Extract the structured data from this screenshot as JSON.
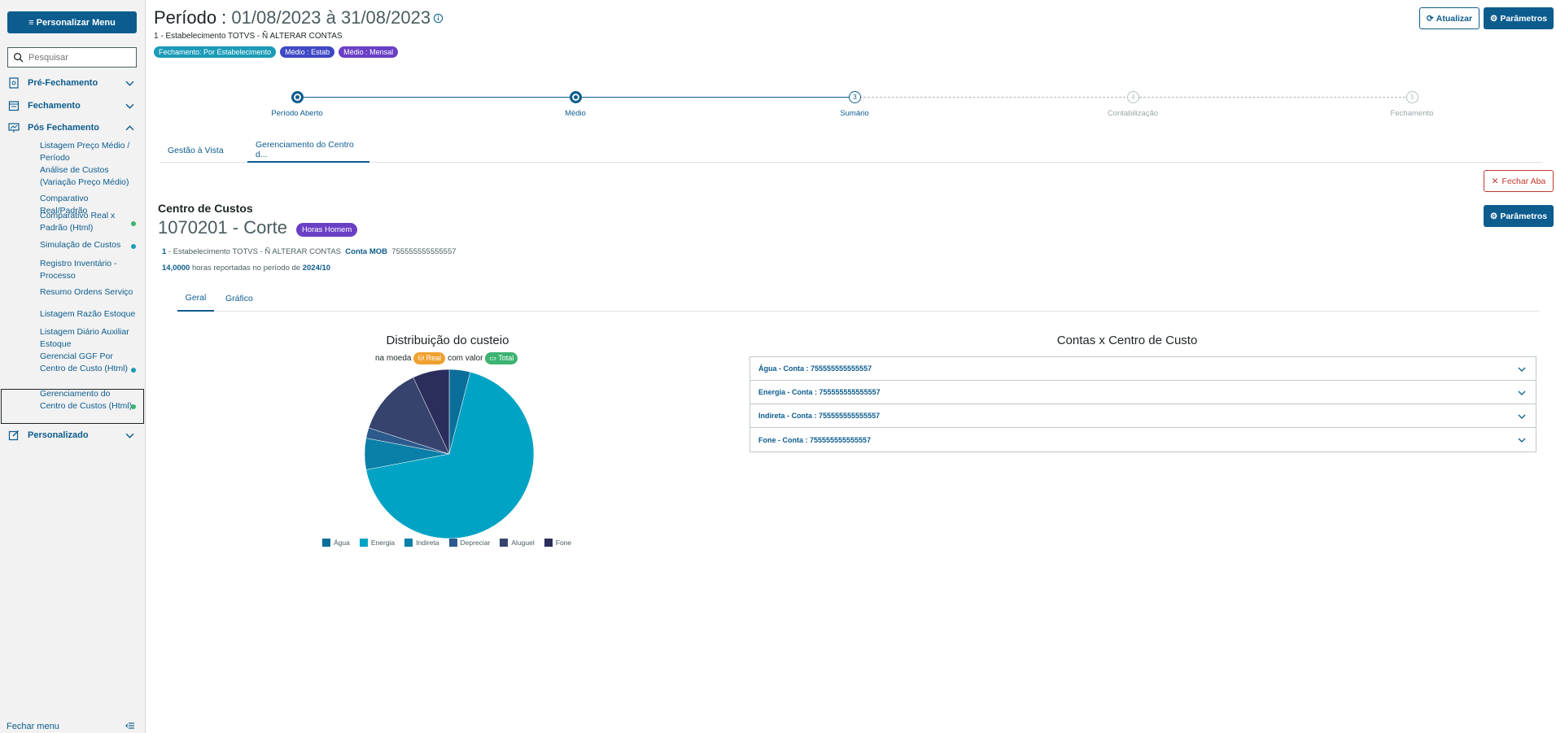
{
  "sidebar": {
    "menu_button": "≡ Personalizar Menu",
    "search_placeholder": "Pesquisar",
    "sections": [
      {
        "label": "Pré-Fechamento"
      },
      {
        "label": "Fechamento"
      },
      {
        "label": "Pós Fechamento"
      },
      {
        "label": "Personalizado"
      }
    ],
    "sub_items": [
      {
        "label": "Listagem Preço Médio / Período"
      },
      {
        "label": "Análise de Custos (Variação Preço Médio)"
      },
      {
        "label": "Comparativo Real/Padrão"
      },
      {
        "label": "Comparativo Real x Padrão (Html)"
      },
      {
        "label": "Simulação de Custos"
      },
      {
        "label": "Registro Inventário - Processo"
      },
      {
        "label": "Resumo Ordens Serviço"
      },
      {
        "label": "Listagem Razão Estoque"
      },
      {
        "label": "Listagem Diário Auxiliar Estoque"
      },
      {
        "label": "Gerencial GGF Por Centro de Custo (Html)"
      },
      {
        "label": "Gerenciamento do Centro de Custos (Html)"
      }
    ],
    "close_menu": "Fechar menu"
  },
  "header": {
    "title_label": "Período :",
    "title_value": "01/08/2023 à 31/08/2023",
    "establishment": "1 - Estabelecimento TOTVS - Ñ ALTERAR CONTAS",
    "tags": [
      {
        "label": "Fechamento: Por Estabelecimento",
        "color": "#1a9bb8"
      },
      {
        "label": "Médio : Estab",
        "color": "#3f48c5"
      },
      {
        "label": "Médio : Mensal",
        "color": "#6b3fc5"
      }
    ],
    "refresh_button": "Atualizar",
    "params_button": "Parâmetros"
  },
  "stepper": {
    "steps": [
      {
        "number": "1",
        "label": "Período Aberto",
        "state": "done"
      },
      {
        "number": "2",
        "label": "Médio",
        "state": "done"
      },
      {
        "number": "3",
        "label": "Sumário",
        "state": "current"
      },
      {
        "number": "4",
        "label": "Contabilização",
        "state": "pending"
      },
      {
        "number": "5",
        "label": "Fechamento",
        "state": "pending"
      }
    ]
  },
  "tabs": [
    {
      "label": "Gestão à Vista"
    },
    {
      "label": "Gerenciamento do Centro d..."
    }
  ],
  "close_tab_button": "Fechar Aba",
  "cost_center": {
    "section_label": "Centro de Custos",
    "name": "1070201 - Corte",
    "badge": "Horas Homem",
    "estab_number": "1",
    "estab_text": "- Estabelecimento TOTVS - Ñ ALTERAR CONTAS",
    "account_label": "Conta MOB",
    "account_value": "755555555555557",
    "hours_value": "14,0000",
    "hours_text": "horas reportadas no período de",
    "period": "2024/10",
    "params_button": "Parâmetros"
  },
  "subtabs": [
    {
      "label": "Geral"
    },
    {
      "label": "Gráfico"
    }
  ],
  "distribution": {
    "title": "Distribuição do custeio",
    "prefix": "na moeda",
    "currency_pill": "Real",
    "middle": "com valor",
    "value_pill": "Total"
  },
  "chart_data": {
    "type": "pie",
    "title": "Distribuição do custeio",
    "categories": [
      "Água",
      "Energia",
      "Indireta",
      "Depreciar",
      "Aluguel",
      "Fone"
    ],
    "values": [
      4,
      68,
      6,
      2,
      13,
      7
    ],
    "colors": [
      "#0b6e99",
      "#00a3c4",
      "#0a7fa8",
      "#2d5a8c",
      "#36436e",
      "#2b2d5c"
    ],
    "legend_position": "bottom"
  },
  "accounts": {
    "title": "Contas x Centro de Custo",
    "items": [
      {
        "label": "Água - Conta : 755555555555557"
      },
      {
        "label": "Energia - Conta : 755555555555557"
      },
      {
        "label": "Indireta - Conta : 755555555555557"
      },
      {
        "label": "Fone - Conta : 755555555555557"
      }
    ]
  }
}
